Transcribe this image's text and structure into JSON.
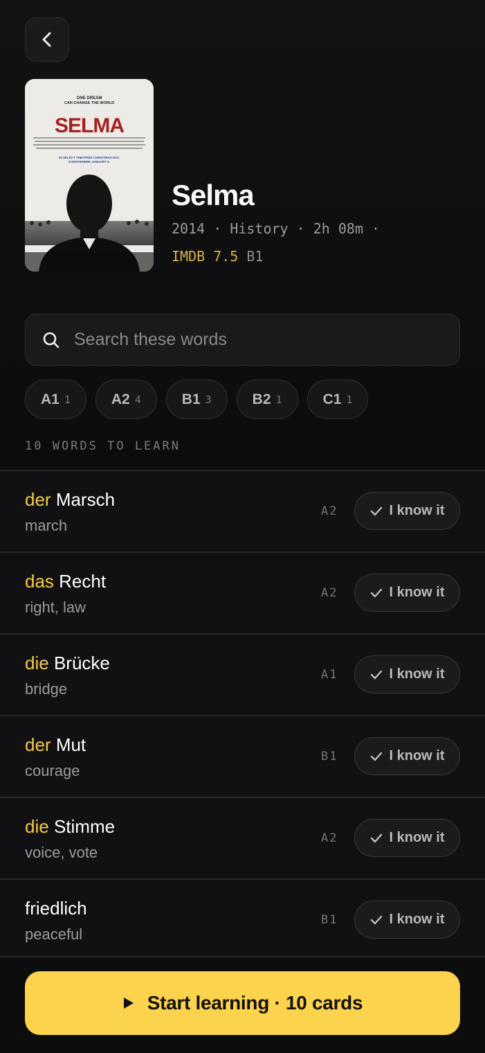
{
  "movie": {
    "title": "Selma",
    "year": "2014",
    "genre": "History",
    "duration": "2h 08m",
    "separator": "·",
    "imdb": "IMDB 7.5",
    "level": "B1",
    "poster": {
      "tagline_1": "ONE DREAM",
      "tagline_2": "CAN CHANGE THE WORLD",
      "title": "SELMA",
      "release_1": "IN SELECT THEATRES CHRISTMAS DAY.",
      "release_2": "EVERYWHERE JANUARY 9."
    }
  },
  "search": {
    "placeholder": "Search these words"
  },
  "chips": [
    {
      "level": "A1",
      "count": "1"
    },
    {
      "level": "A2",
      "count": "4"
    },
    {
      "level": "B1",
      "count": "3"
    },
    {
      "level": "B2",
      "count": "1"
    },
    {
      "level": "C1",
      "count": "1"
    }
  ],
  "section_label": "10 WORDS TO LEARN",
  "words": [
    {
      "article": "der",
      "word": "Marsch",
      "translation": "march",
      "level": "A2"
    },
    {
      "article": "das",
      "word": "Recht",
      "translation": "right, law",
      "level": "A2"
    },
    {
      "article": "die",
      "word": "Brücke",
      "translation": "bridge",
      "level": "A1"
    },
    {
      "article": "der",
      "word": "Mut",
      "translation": "courage",
      "level": "B1"
    },
    {
      "article": "die",
      "word": "Stimme",
      "translation": "voice, vote",
      "level": "A2"
    },
    {
      "article": "",
      "word": "friedlich",
      "translation": "peaceful",
      "level": "B1"
    }
  ],
  "know_label": "I know it",
  "start_button": {
    "label": "Start learning · 10 cards"
  },
  "colors": {
    "accent": "#fcd34d",
    "article": "#f2cc4c",
    "imdb": "#d6b24a",
    "background": "#0c0c0d"
  }
}
